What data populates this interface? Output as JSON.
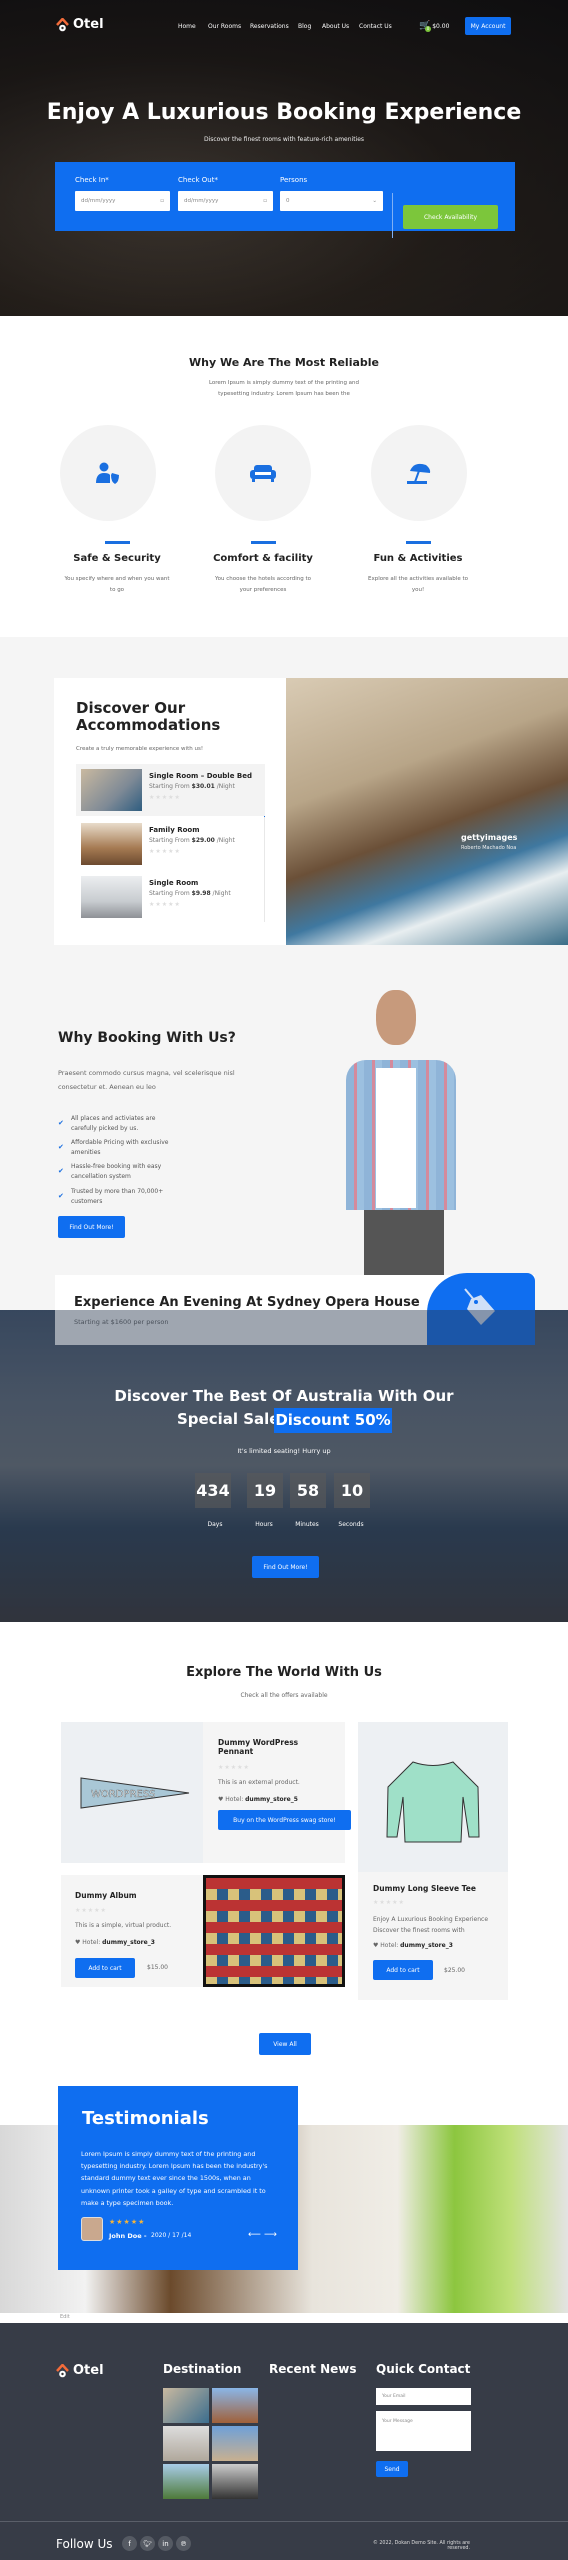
{
  "brand": "Otel",
  "nav": {
    "items": [
      "Home",
      "Our Rooms",
      "Reservations",
      "Blog",
      "About Us",
      "Contact Us"
    ],
    "cart_total": "$0.00",
    "cart_count": "0",
    "account": "My Account"
  },
  "hero": {
    "title": "Enjoy A Luxurious Booking Experience",
    "subtitle": "Discover the finest rooms with feature-rich amenities",
    "form": {
      "checkin_label": "Check In*",
      "checkin_placeholder": "dd/mm/yyyy",
      "checkout_label": "Check Out*",
      "checkout_placeholder": "dd/mm/yyyy",
      "persons_label": "Persons",
      "persons_value": "0",
      "submit": "Check Availability"
    }
  },
  "reliable": {
    "title": "Why We Are The Most Reliable",
    "text": "Lorem Ipsum is simply dummy text of the printing and typesetting industry. Lorem Ipsum has been the",
    "features": [
      {
        "title": "Safe & Security",
        "text": "You specify where and when you want to go",
        "icon": "user-shield-icon"
      },
      {
        "title": "Comfort & facility",
        "text": "You choose the hotels according to your preferences",
        "icon": "sofa-icon"
      },
      {
        "title": "Fun & Activities",
        "text": "Explore all the activities available to you!",
        "icon": "beach-umbrella-icon"
      }
    ]
  },
  "accommodations": {
    "title": "Discover Our Accommodations",
    "subtitle": "Create a truly memorable experience with us!",
    "rooms": [
      {
        "name": "Single Room – Double Bed",
        "prefix": "Starting From",
        "price": "$30.01",
        "suffix": "/Night"
      },
      {
        "name": "Family Room",
        "prefix": "Starting From",
        "price": "$29.00",
        "suffix": "/Night"
      },
      {
        "name": "Single Room",
        "prefix": "Starting From",
        "price": "$9.98",
        "suffix": "/Night"
      }
    ],
    "watermark": "gettyimages",
    "credit": "Roberto Machado Noa"
  },
  "why": {
    "title": "Why Booking With Us?",
    "text": "Praesent commodo cursus magna, vel scelerisque nisl consectetur et. Aenean eu leo",
    "points": [
      "All places and activiates are carefully picked by us.",
      "Affordable Pricing with exclusive amenities",
      "Hassle-free booking with easy cancellation system",
      "Trusted by more than 70,000+ customers"
    ],
    "button": "Find Out More!"
  },
  "experience": {
    "title": "Experience An Evening At Sydney Opera House",
    "subtitle": "Starting at $1600 per person"
  },
  "sale": {
    "title1": "Discover The Best Of Australia With Our",
    "title2": "Special Sale",
    "badge": "Discount 50%",
    "note": "It's limited seating! Hurry up",
    "countdown": [
      {
        "value": "434",
        "label": "Days"
      },
      {
        "value": "19",
        "label": "Hours"
      },
      {
        "value": "58",
        "label": "Minutes"
      },
      {
        "value": "10",
        "label": "Seconds"
      }
    ],
    "button": "Find Out More!"
  },
  "explore": {
    "title": "Explore The World With Us",
    "subtitle": "Check all the offers available",
    "hotel_label": "Hotel:",
    "products": [
      {
        "name": "Dummy WordPress Pennant",
        "desc": "This is an external product.",
        "store": "dummy_store_5",
        "button": "Buy on the WordPress swag store!"
      },
      {
        "name": "Dummy Album",
        "desc": "This is a simple, virtual product.",
        "store": "dummy_store_3",
        "button": "Add to cart",
        "price": "$15.00"
      },
      {
        "name": "Dummy Long Sleeve Tee",
        "desc": "Enjoy A Luxurious Booking Experience Discover the finest rooms with",
        "store": "dummy_store_3",
        "button": "Add to cart",
        "price": "$25.00"
      }
    ],
    "pennant_text": "WORDPRESS",
    "view_all": "View All"
  },
  "testimonials": {
    "title": "Testimonials",
    "quote": "Lorem Ipsum is simply dummy text of the printing and typesetting industry. Lorem Ipsum has been the industry's standard dummy text ever since the 1500s, when an unknown printer took a galley of type and scrambled it to make a type specimen book.",
    "stars": "★★★★★",
    "rating": 5,
    "author": "John Doe -",
    "date": "2020 / 17 /14"
  },
  "edit_link": "Edit",
  "footer": {
    "destination": "Destination",
    "news": "Recent News",
    "contact": "Quick Contact",
    "email_placeholder": "Your Email",
    "message_placeholder": "Your Message",
    "send": "Send",
    "follow": "Follow Us",
    "copyright": "© 2022, Dokan Demo Site. All rights are reserved."
  },
  "colors": {
    "accent": "#0f6ef0",
    "green": "#7cc63b",
    "footer": "#373c47"
  }
}
